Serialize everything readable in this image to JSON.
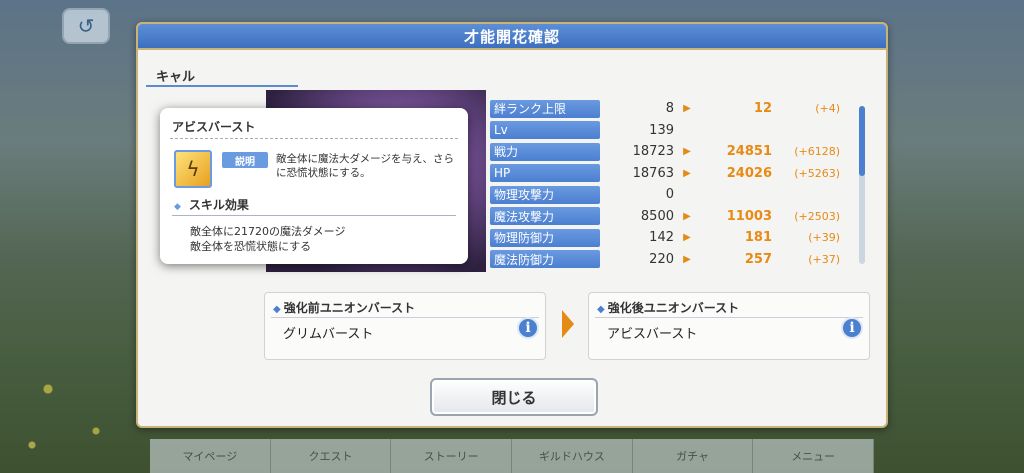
{
  "dialog": {
    "title": "才能開花確認",
    "character_name": "キャル",
    "close_label": "閉じる"
  },
  "stats": [
    {
      "label": "絆ランク上限",
      "before": "8",
      "after": "12",
      "diff": "(+4)"
    },
    {
      "label": "Lv",
      "before": "139",
      "after": "",
      "diff": ""
    },
    {
      "label": "戦力",
      "before": "18723",
      "after": "24851",
      "diff": "(+6128)"
    },
    {
      "label": "HP",
      "before": "18763",
      "after": "24026",
      "diff": "(+5263)"
    },
    {
      "label": "物理攻撃力",
      "before": "0",
      "after": "",
      "diff": ""
    },
    {
      "label": "魔法攻撃力",
      "before": "8500",
      "after": "11003",
      "diff": "(+2503)"
    },
    {
      "label": "物理防御力",
      "before": "142",
      "after": "181",
      "diff": "(+39)"
    },
    {
      "label": "魔法防御力",
      "before": "220",
      "after": "257",
      "diff": "(+37)"
    }
  ],
  "union_burst": {
    "before_title": "強化前ユニオンバースト",
    "before_name": "グリムバースト",
    "after_title": "強化後ユニオンバースト",
    "after_name": "アビスバースト"
  },
  "popup": {
    "title": "アビスバースト",
    "desc_tag": "説明",
    "description": "敵全体に魔法大ダメージを与え、さらに恐慌状態にする。",
    "effect_heading": "スキル効果",
    "effect_line1": "敵全体に21720の魔法ダメージ",
    "effect_line2": "敵全体を恐慌状態にする"
  },
  "bottom_nav": [
    "マイページ",
    "クエスト",
    "ストーリー",
    "ギルドハウス",
    "ガチャ",
    "メニュー"
  ],
  "colors": {
    "accent": "#4b7fd0",
    "increase": "#e88a14",
    "frame": "#c9b37a"
  }
}
